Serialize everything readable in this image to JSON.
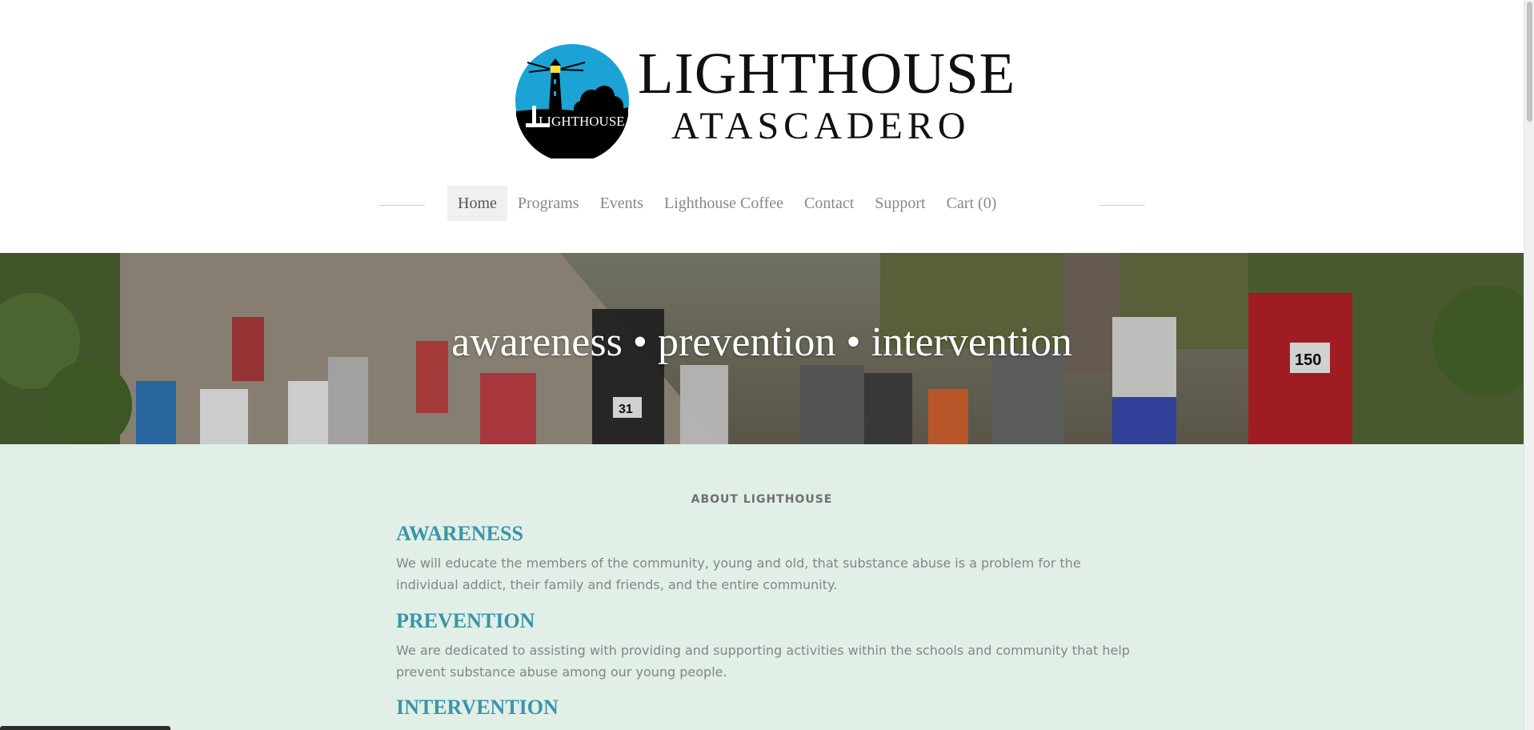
{
  "brand": {
    "title": "LIGHTHOUSE",
    "subtitle": "ATASCADERO",
    "emblem_text": "LIGHTHOUSE",
    "colors": {
      "emblem_blue": "#1aa3d4",
      "ink": "#111111"
    }
  },
  "nav": {
    "items": [
      {
        "label": "Home",
        "active": true
      },
      {
        "label": "Programs",
        "active": false
      },
      {
        "label": "Events",
        "active": false
      },
      {
        "label": "Lighthouse Coffee",
        "active": false
      },
      {
        "label": "Contact",
        "active": false
      },
      {
        "label": "Support",
        "active": false
      },
      {
        "label": "Cart (0)",
        "active": false
      }
    ]
  },
  "hero": {
    "tagline": "awareness • prevention • intervention",
    "bib_numbers": [
      "150",
      "31"
    ]
  },
  "about": {
    "label": "ABOUT LIGHTHOUSE",
    "sections": [
      {
        "heading": "AWARENESS",
        "body": "We will educate the members of the community, young and old, that substance abuse is a problem for the individual addict, their family and friends, and the entire community."
      },
      {
        "heading": "PREVENTION",
        "body": "We are dedicated to assisting with providing and supporting activities within the schools and community that help prevent substance abuse among our young people."
      },
      {
        "heading": "INTERVENTION",
        "body": ""
      }
    ],
    "colors": {
      "background": "#e1efe7",
      "heading": "#3a95a8",
      "text": "#858585"
    }
  }
}
